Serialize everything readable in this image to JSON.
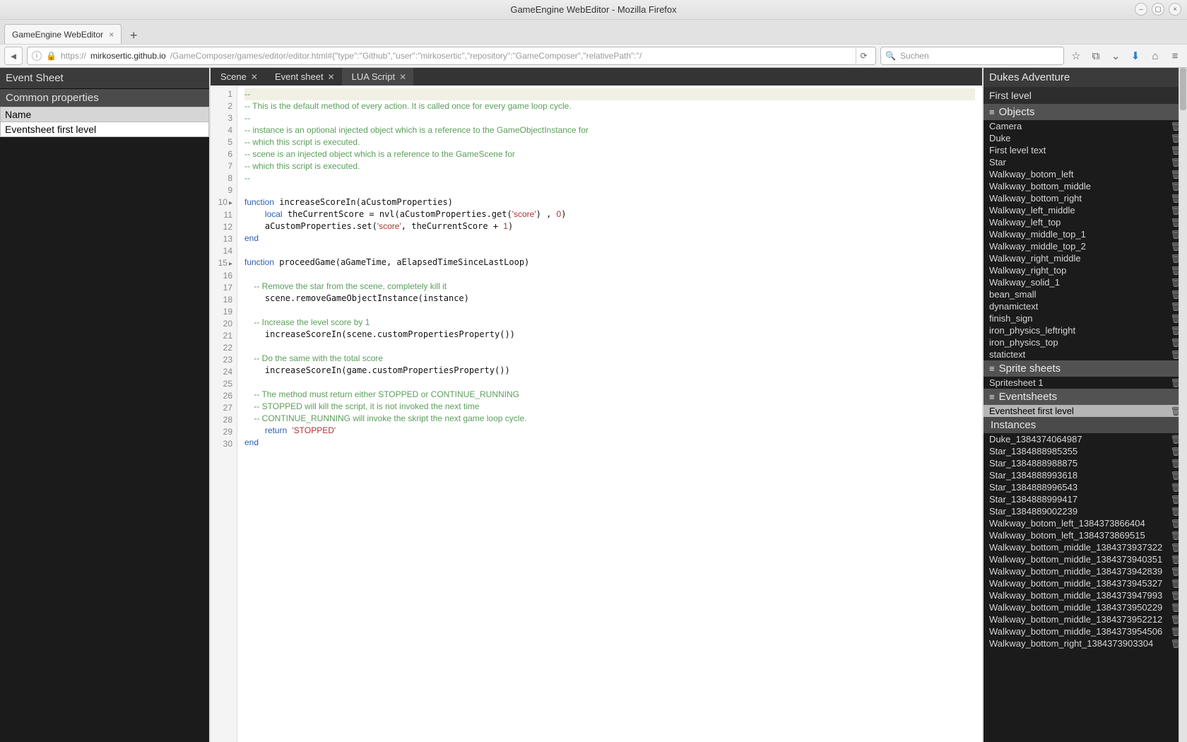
{
  "window": {
    "title": "GameEngine WebEditor - Mozilla Firefox"
  },
  "browser": {
    "tab_title": "GameEngine WebEditor",
    "url_prefix": "https://",
    "url_host": "mirkosertic.github.io",
    "url_path": "/GameComposer/games/editor/editor.html#{\"type\":\"Github\",\"user\":\"mirkosertic\",\"repository\":\"GameComposer\",\"relativePath\":\"/",
    "search_placeholder": "Suchen"
  },
  "left": {
    "title": "Event Sheet",
    "section": "Common properties",
    "prop_name_label": "Name",
    "prop_name_value": "Eventsheet first level"
  },
  "tabs": [
    {
      "label": "Scene",
      "closable": true
    },
    {
      "label": "Event sheet",
      "closable": true
    },
    {
      "label": "LUA Script",
      "closable": true,
      "active": true
    }
  ],
  "code": {
    "lines": [
      {
        "n": 1,
        "t": "comment",
        "text": "--"
      },
      {
        "n": 2,
        "t": "comment",
        "text": "-- This is the default method of every action. It is called once for every game loop cycle."
      },
      {
        "n": 3,
        "t": "comment",
        "text": "--"
      },
      {
        "n": 4,
        "t": "comment",
        "text": "-- instance is an optional injected object which is a reference to the GameObjectInstance for"
      },
      {
        "n": 5,
        "t": "comment",
        "text": "-- which this script is executed."
      },
      {
        "n": 6,
        "t": "comment",
        "text": "-- scene is an injected object which is a reference to the GameScene for"
      },
      {
        "n": 7,
        "t": "comment",
        "text": "-- which this script is executed."
      },
      {
        "n": 8,
        "t": "comment",
        "text": "--"
      },
      {
        "n": 9,
        "t": "blank",
        "text": ""
      },
      {
        "n": 10,
        "t": "code",
        "html": "<span class='c-kw'>function</span> increaseScoreIn(aCustomProperties)",
        "mark": true
      },
      {
        "n": 11,
        "t": "code",
        "html": "    <span class='c-kw'>local</span> theCurrentScore = nvl(aCustomProperties.get(<span class='c-str'>'score'</span>) , <span class='c-num'>0</span>)"
      },
      {
        "n": 12,
        "t": "code",
        "html": "    aCustomProperties.set(<span class='c-str'>'score'</span>, theCurrentScore + <span class='c-num'>1</span>)"
      },
      {
        "n": 13,
        "t": "code",
        "html": "<span class='c-kw'>end</span>"
      },
      {
        "n": 14,
        "t": "blank",
        "text": ""
      },
      {
        "n": 15,
        "t": "code",
        "html": "<span class='c-kw'>function</span> proceedGame(aGameTime, aElapsedTimeSinceLastLoop)",
        "mark": true
      },
      {
        "n": 16,
        "t": "blank",
        "text": ""
      },
      {
        "n": 17,
        "t": "comment",
        "text": "    -- Remove the star from the scene, completely kill it"
      },
      {
        "n": 18,
        "t": "code",
        "html": "    scene.removeGameObjectInstance(instance)"
      },
      {
        "n": 19,
        "t": "blank",
        "text": ""
      },
      {
        "n": 20,
        "t": "comment",
        "text": "    -- Increase the level score by 1"
      },
      {
        "n": 21,
        "t": "code",
        "html": "    increaseScoreIn(scene.customPropertiesProperty())"
      },
      {
        "n": 22,
        "t": "blank",
        "text": ""
      },
      {
        "n": 23,
        "t": "comment",
        "text": "    -- Do the same with the total score"
      },
      {
        "n": 24,
        "t": "code",
        "html": "    increaseScoreIn(game.customPropertiesProperty())"
      },
      {
        "n": 25,
        "t": "blank",
        "text": ""
      },
      {
        "n": 26,
        "t": "comment",
        "text": "    -- The method must return either STOPPED or CONTINUE_RUNNING"
      },
      {
        "n": 27,
        "t": "comment",
        "text": "    -- STOPPED will kill the script, it is not invoked the next time"
      },
      {
        "n": 28,
        "t": "comment",
        "text": "    -- CONTINUE_RUNNING will invoke the skript the next game loop cycle."
      },
      {
        "n": 29,
        "t": "code",
        "html": "    <span class='c-kw'>return</span> <span class='c-str'>'STOPPED'</span>"
      },
      {
        "n": 30,
        "t": "code",
        "html": "<span class='c-kw'>end</span>"
      }
    ]
  },
  "right": {
    "title": "Dukes Adventure",
    "subtitle": "First level",
    "sections": {
      "objects_label": "Objects",
      "sprites_label": "Sprite sheets",
      "eventsheets_label": "Eventsheets",
      "instances_label": "Instances"
    },
    "objects": [
      "Camera",
      "Duke",
      "First level text",
      "Star",
      "Walkway_botom_left",
      "Walkway_bottom_middle",
      "Walkway_bottom_right",
      "Walkway_left_middle",
      "Walkway_left_top",
      "Walkway_middle_top_1",
      "Walkway_middle_top_2",
      "Walkway_right_middle",
      "Walkway_right_top",
      "Walkway_solid_1",
      "bean_small",
      "dynamictext",
      "finish_sign",
      "iron_physics_leftright",
      "iron_physics_top",
      "statictext"
    ],
    "spritesheets": [
      "Spritesheet 1"
    ],
    "eventsheets": [
      {
        "name": "Eventsheet first level",
        "selected": true
      }
    ],
    "instances": [
      "Duke_1384374064987",
      "Star_1384888985355",
      "Star_1384888988875",
      "Star_1384888993618",
      "Star_1384888996543",
      "Star_1384888999417",
      "Star_1384889002239",
      "Walkway_botom_left_1384373866404",
      "Walkway_botom_left_1384373869515",
      "Walkway_bottom_middle_1384373937322",
      "Walkway_bottom_middle_1384373940351",
      "Walkway_bottom_middle_1384373942839",
      "Walkway_bottom_middle_1384373945327",
      "Walkway_bottom_middle_1384373947993",
      "Walkway_bottom_middle_1384373950229",
      "Walkway_bottom_middle_1384373952212",
      "Walkway_bottom_middle_1384373954506",
      "Walkway_bottom_right_1384373903304"
    ]
  }
}
